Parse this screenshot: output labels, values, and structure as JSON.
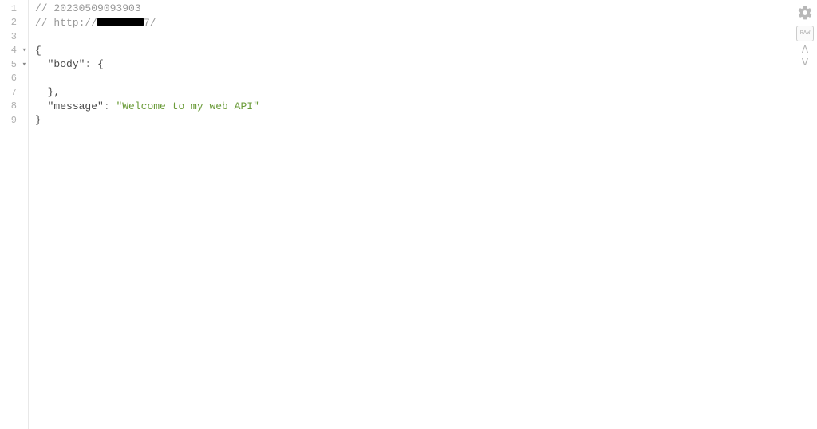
{
  "lines": {
    "1": "1",
    "2": "2",
    "3": "3",
    "4": "4",
    "5": "5",
    "6": "6",
    "7": "7",
    "8": "8",
    "9": "9"
  },
  "code": {
    "l1_comment": "// 20230509093903",
    "l2_prefix": "// http://",
    "l2_suffix": "7/",
    "l4_brace": "{",
    "l5_indent": "  ",
    "l5_key": "\"body\"",
    "l5_colon": ": ",
    "l5_brace": "{",
    "l7_indent": "  ",
    "l7_close": "},",
    "l8_indent": "  ",
    "l8_key": "\"message\"",
    "l8_colon": ": ",
    "l8_value": "\"Welcome to my web API\"",
    "l9_brace": "}"
  },
  "toolbar": {
    "fold": "▾",
    "raw": "RAW",
    "up": "ᐱ",
    "down": "ᐯ"
  }
}
